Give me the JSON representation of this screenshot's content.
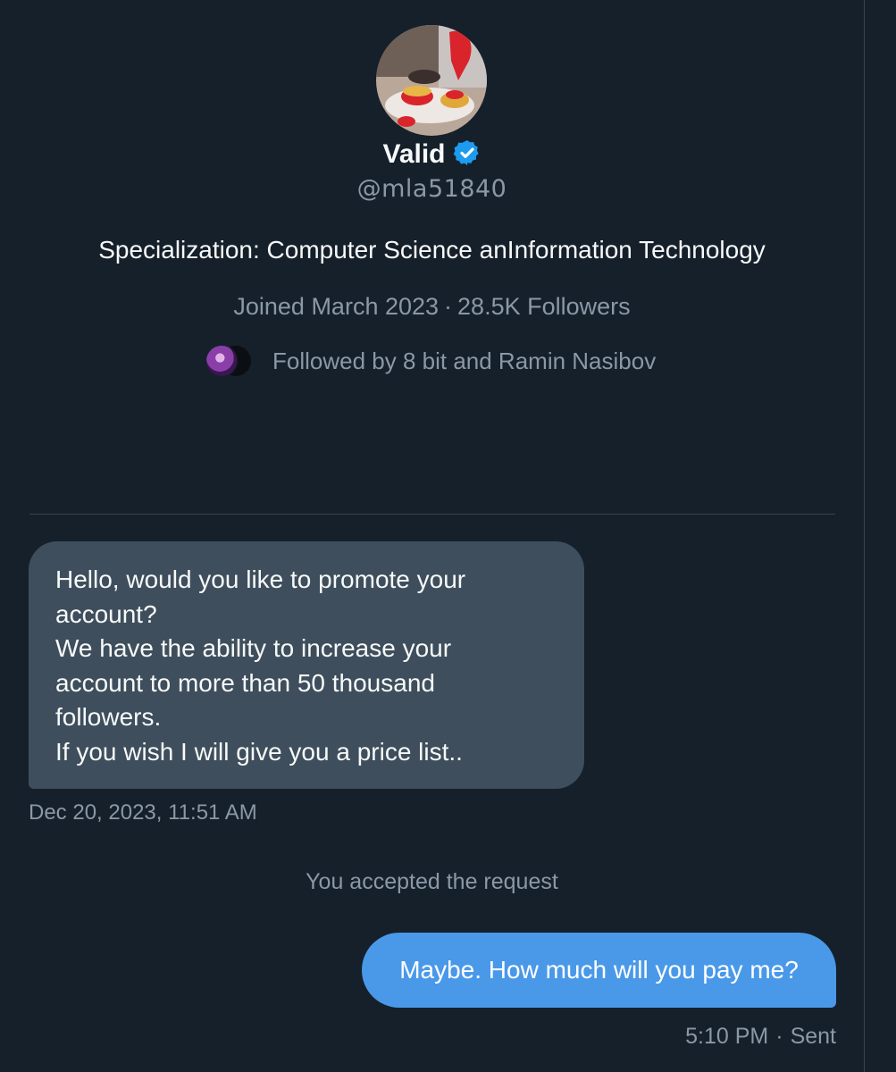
{
  "profile": {
    "display_name": "Valid",
    "verified_icon": "verified-badge-icon",
    "handle": "@mla51840",
    "bio": "Specialization: Computer Science anInformation Technology",
    "joined": "Joined March 2023",
    "separator": "·",
    "followers": "28.5K Followers",
    "followed_by": "Followed by 8 bit and Ramin Nasibov"
  },
  "conversation": {
    "incoming_message": {
      "lines": [
        "Hello, would you like to promote your",
        "account?",
        "We have the ability to increase your",
        "account to more than 50 thousand",
        "followers.",
        "If you wish I will give you a price list.."
      ],
      "timestamp": "Dec 20, 2023, 11:51 AM"
    },
    "system_note": "You accepted the request",
    "outgoing_message": {
      "text": "Maybe. How much will you pay me?",
      "time": "5:10 PM",
      "separator": "·",
      "status": "Sent"
    }
  },
  "colors": {
    "background": "#15202b",
    "incoming_bubble": "#3e4e5c",
    "outgoing_bubble": "#4a99e9",
    "verified_blue": "#1d9bf0",
    "secondary_text": "#8b98a5"
  }
}
